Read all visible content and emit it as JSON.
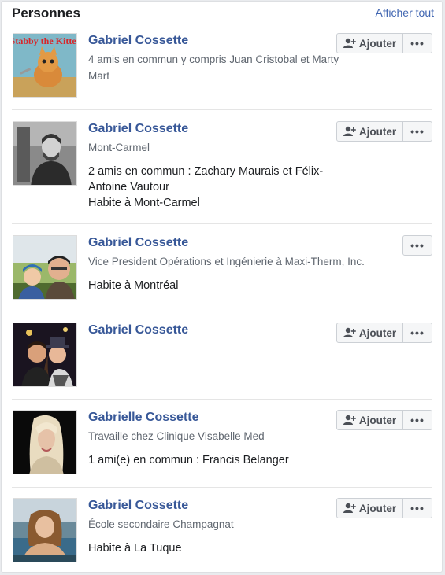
{
  "header": {
    "title": "Personnes",
    "see_all": "Afficher tout"
  },
  "colors": {
    "link": "#385898",
    "text": "#1c1e21",
    "muted": "#606770"
  },
  "people": [
    {
      "name": "Gabriel Cossette",
      "sub": "4 amis en commun y compris Juan Cristobal et Marty Mart",
      "details": [],
      "add_label": "Ajouter",
      "avatar_text": "Stabby the Kitten"
    },
    {
      "name": "Gabriel Cossette",
      "sub": "Mont-Carmel",
      "details": [
        "2 amis en commun : Zachary Maurais et Félix-Antoine Vautour",
        "Habite à Mont-Carmel"
      ],
      "add_label": "Ajouter"
    },
    {
      "name": "Gabriel Cossette",
      "sub": "Vice President Opérations et Ingénierie à Maxi-Therm, Inc.",
      "details": [
        "Habite à Montréal"
      ]
    },
    {
      "name": "Gabriel Cossette",
      "sub": "",
      "details": [],
      "add_label": "Ajouter"
    },
    {
      "name": "Gabrielle Cossette",
      "sub": "Travaille chez Clinique Visabelle Med",
      "details": [
        "1 ami(e) en commun : Francis Belanger"
      ],
      "add_label": "Ajouter"
    },
    {
      "name": "Gabriel Cossette",
      "sub": "École secondaire Champagnat",
      "details": [
        "Habite à La Tuque"
      ],
      "add_label": "Ajouter"
    }
  ],
  "more_label": "•••"
}
